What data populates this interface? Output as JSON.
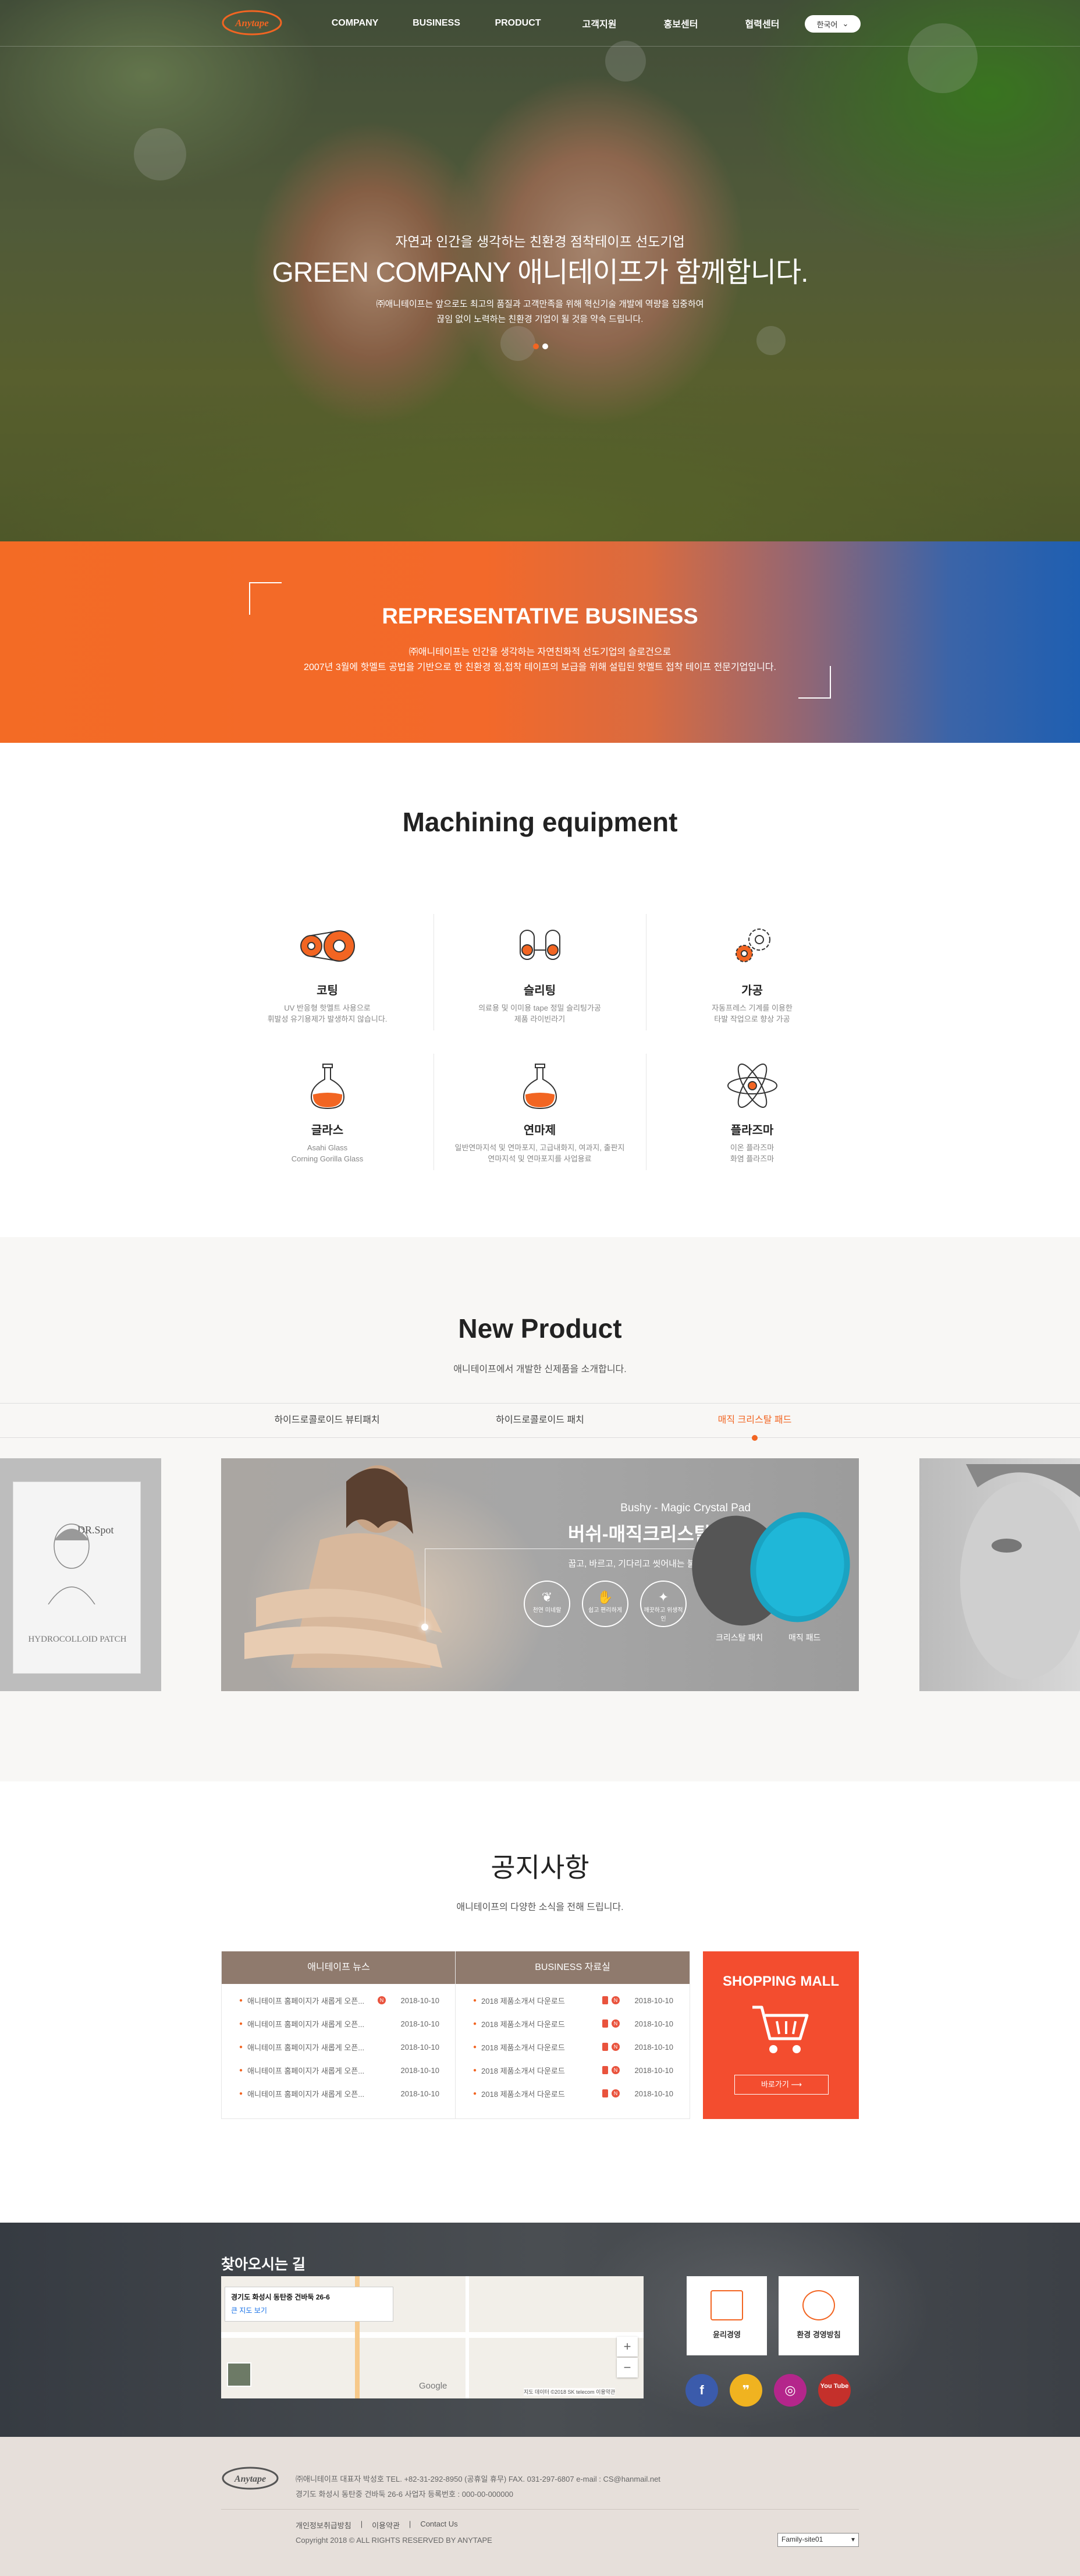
{
  "header": {
    "logo_text": "Anytape",
    "nav": [
      "COMPANY",
      "BUSINESS",
      "PRODUCT",
      "고객지원",
      "홍보센터",
      "협력센터"
    ],
    "lang": "한국어"
  },
  "hero": {
    "subtitle": "자연과 인간을 생각하는 친환경 점착테이프 선도기업",
    "title": "GREEN COMPANY 애니테이프가 함께합니다.",
    "desc_line1": "㈜애니테이프는 앞으로도 최고의 품질과 고객만족을 위해 혁신기술 개발에 역량을 집중하여",
    "desc_line2": "끊임 없이 노력하는 친환경 기업이 될 것을 약속 드립니다."
  },
  "rep": {
    "title": "REPRESENTATIVE BUSINESS",
    "desc_line1": "㈜애니테이프는 인간을 생각하는 자연친화적 선도기업의 슬로건으로",
    "desc_line2": "2007년 3월에 핫멜트 공법을 기반으로 한 친환경 점,접착 테이프의 보급을 위해 설립된 핫멜트 접착 테이프 전문기업입니다."
  },
  "machining": {
    "title": "Machining equipment",
    "items": [
      {
        "name": "코팅",
        "desc1": "UV 반응형 핫멜트 사용으로",
        "desc2": "휘발성 유기용제가 발생하지 않습니다."
      },
      {
        "name": "슬리팅",
        "desc1": "의료용 및 이미용 tape 정밀 슬리팅가공",
        "desc2": "제품 라이빈라기"
      },
      {
        "name": "가공",
        "desc1": "자동프레스 기계를 이용한",
        "desc2": "타발 작업으로 향상 가공"
      },
      {
        "name": "글라스",
        "desc1": "Asahi Glass",
        "desc2": "Corning Gorilla Glass"
      },
      {
        "name": "연마제",
        "desc1": "일반연마지석 및 연마포지, 고급내화지, 여과지, 출판지",
        "desc2": "연마지석 및 연마포지를 사업용료"
      },
      {
        "name": "플라즈마",
        "desc1": "이온 플라즈마",
        "desc2": "화염 플라즈마"
      }
    ]
  },
  "new_product": {
    "title": "New Product",
    "subtitle": "애니테이프에서 개발한 신제품을 소개합니다.",
    "tabs": [
      "하이드로콜로이드 뷰티패치",
      "하이드로콜로이드 패치",
      "매직 크리스탈 패드"
    ],
    "active_tab": 2,
    "left_card": {
      "brand": "DR.Spot",
      "label": "HYDROCOLLOID PATCH"
    },
    "main_card": {
      "en": "Bushy - Magic Crystal Pad",
      "ko": "버쉬-매직크리스탈 패드",
      "desc": "꿉고, 바르고, 기다리고 씻어내는 불편함 이제는 끝!",
      "circles": [
        "천연 미네랄",
        "쉽고 편리하게",
        "깨끗하고 위생적인"
      ],
      "pad_labels": [
        "크리스탈 패치",
        "매직 패드"
      ]
    }
  },
  "notice": {
    "title": "공지사항",
    "subtitle": "애니테이프의 다양한 소식을 전해 드립니다.",
    "boards": [
      {
        "head": "애니테이프 뉴스",
        "rows": [
          {
            "title": "애니테이프 홈페이지가 새롭게 오픈...",
            "date": "2018-10-10"
          },
          {
            "title": "애니테이프 홈페이지가 새롭게 오픈...",
            "date": "2018-10-10"
          },
          {
            "title": "애니테이프 홈페이지가 새롭게 오픈...",
            "date": "2018-10-10"
          },
          {
            "title": "애니테이프 홈페이지가 새롭게 오픈...",
            "date": "2018-10-10"
          },
          {
            "title": "애니테이프 홈페이지가 새롭게 오픈...",
            "date": "2018-10-10"
          }
        ]
      },
      {
        "head": "BUSINESS 자료실",
        "rows": [
          {
            "title": "2018 제품소개서 다운로드",
            "date": "2018-10-10"
          },
          {
            "title": "2018 제품소개서 다운로드",
            "date": "2018-10-10"
          },
          {
            "title": "2018 제품소개서 다운로드",
            "date": "2018-10-10"
          },
          {
            "title": "2018 제품소개서 다운로드",
            "date": "2018-10-10"
          },
          {
            "title": "2018 제품소개서 다운로드",
            "date": "2018-10-10"
          }
        ]
      }
    ],
    "shop": {
      "title": "SHOPPING MALL",
      "button": "바로가기 ⟶"
    }
  },
  "directions": {
    "title": "찾아오시는 길",
    "map_address": "경기도 화성시 동탄중 건바둑 26-6",
    "map_link": "큰 지도 보기",
    "map_google": "Google",
    "map_legal": "지도 데이터 ©2018 SK telecom  이용약관",
    "map_zoom_in": "+",
    "map_zoom_out": "−",
    "boxes": [
      "윤리경영",
      "환경 경영방침"
    ],
    "sns": [
      "f",
      "❞",
      "◎",
      "You Tube"
    ]
  },
  "footer": {
    "logo_text": "Anytape",
    "line1": "㈜애니테이프    대표자 박성호    TEL. +82-31-292-8950 (공휴일 휴무)    FAX. 031-297-6807    e-mail : CS@hanmail.net",
    "line2": "경기도 화성시 동탄중 건바둑 26-6    사업자 등록번호 : 000-00-000000",
    "links": [
      "개인정보취급방침",
      "이용약관",
      "Contact Us"
    ],
    "copy": "Copyright 2018 © ALL RIGHTS RESERVED BY ANYTAPE",
    "family_site": "Family-site01"
  }
}
